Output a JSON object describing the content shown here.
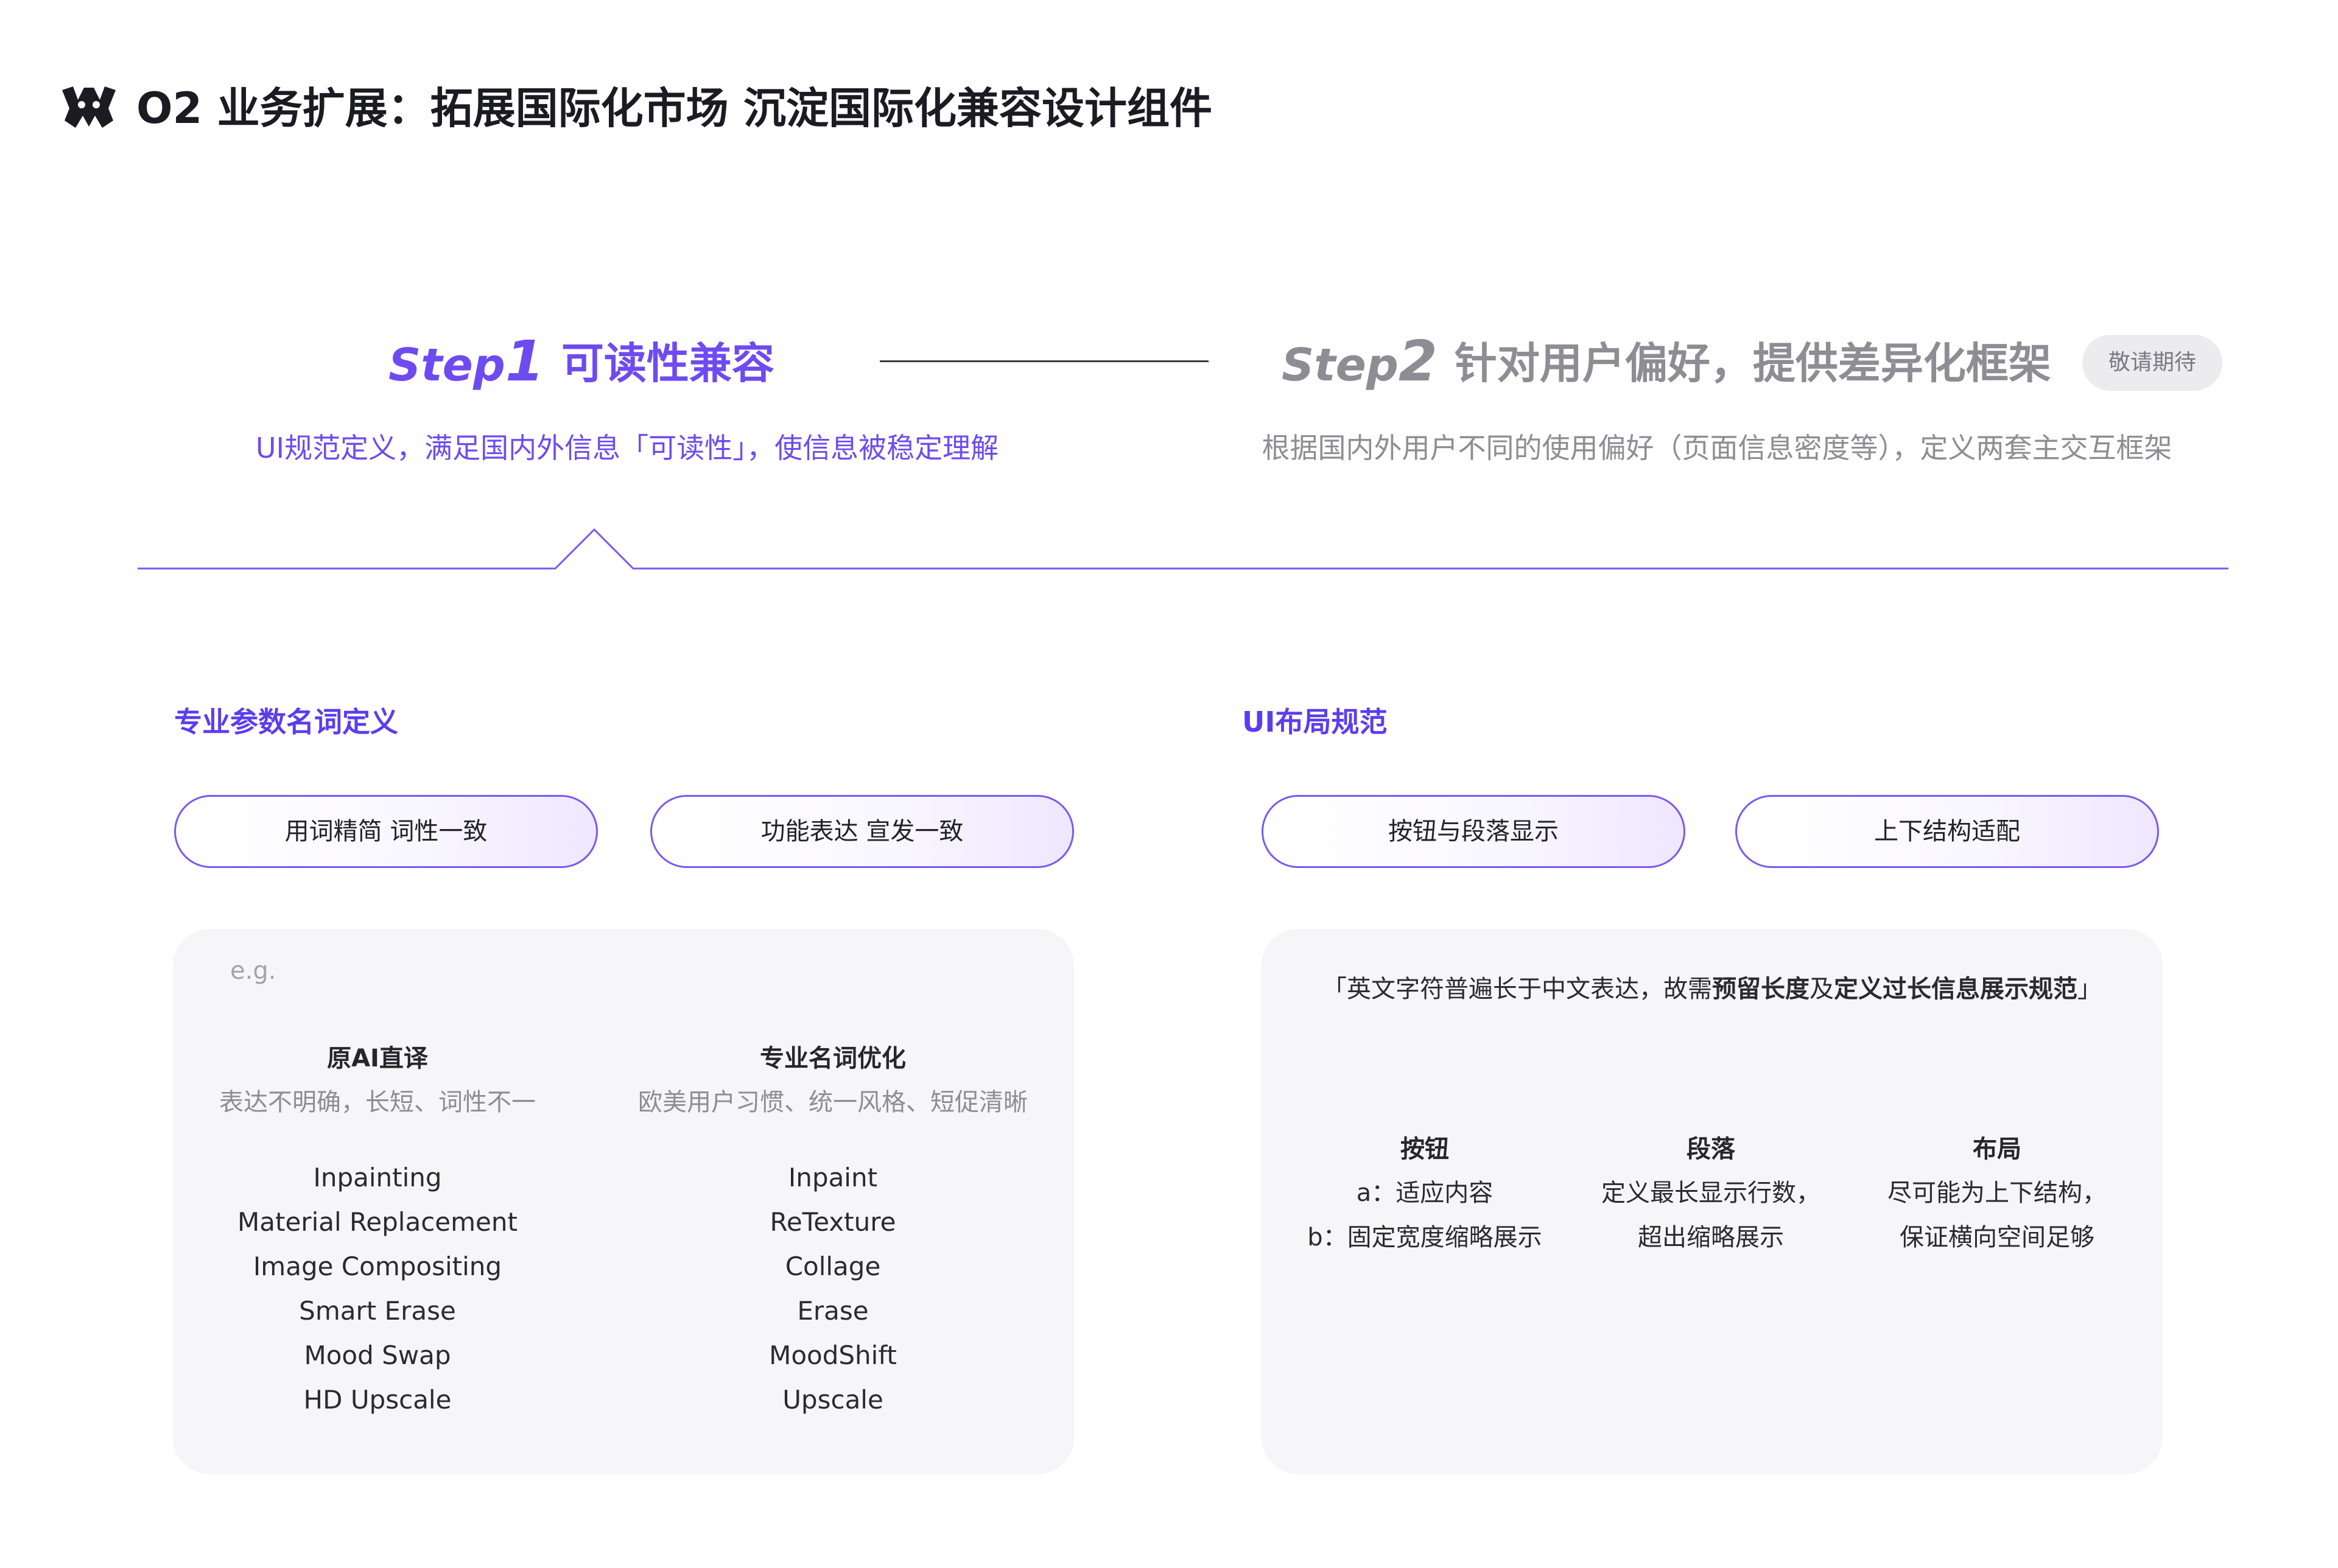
{
  "header": {
    "title": "O2 业务扩展：拓展国际化市场 沉淀国际化兼容设计组件",
    "logo_icon": "brand-logo-icon"
  },
  "steps": {
    "step1": {
      "word": "Step",
      "number": "1",
      "title": "可读性兼容",
      "description": "UI规范定义，满足国内外信息「可读性」，使信息被稳定理解",
      "active": true
    },
    "step2": {
      "word": "Step",
      "number": "2",
      "title": "针对用户偏好，提供差异化框架",
      "badge": "敬请期待",
      "description": "根据国内外用户不同的使用偏好（页面信息密度等），定义两套主交互框架",
      "active": false
    }
  },
  "left_section": {
    "title": "专业参数名词定义",
    "pills": [
      "用词精简 词性一致",
      "功能表达 宣发一致"
    ],
    "card": {
      "eg_label": "e.g.",
      "columns": [
        {
          "heading": "原AI直译",
          "subheading": "表达不明确，长短、词性不一",
          "terms": [
            "Inpainting",
            "Material Replacement",
            "Image Compositing",
            "Smart Erase",
            "Mood Swap",
            "HD Upscale"
          ]
        },
        {
          "heading": "专业名词优化",
          "subheading": "欧美用户习惯、统一风格、短促清晰",
          "terms": [
            "Inpaint",
            "ReTexture",
            "Collage",
            "Erase",
            "MoodShift",
            "Upscale"
          ]
        }
      ]
    }
  },
  "right_section": {
    "title": "UI布局规范",
    "pills": [
      "按钮与段落显示",
      "上下结构适配"
    ],
    "card": {
      "quote": {
        "open": "「",
        "prefix": "英文字符普遍长于中文表达，故需",
        "bold1": "预留长度",
        "middle": "及",
        "bold2": "定义过长信息展示规范",
        "close": "」"
      },
      "rules": [
        {
          "heading": "按钮",
          "lines": [
            "a：适应内容",
            "b：固定宽度缩略展示"
          ]
        },
        {
          "heading": "段落",
          "lines": [
            "定义最长显示行数，",
            "超出缩略展示"
          ]
        },
        {
          "heading": "布局",
          "lines": [
            "尽可能为上下结构，",
            "保证横向空间足够"
          ]
        }
      ]
    }
  },
  "colors": {
    "accent": "#6e4bf0",
    "heading_accent": "#5b3df0",
    "muted": "#8d8d93",
    "card_bg": "#f6f6f8",
    "pill_border": "#7a58f2"
  }
}
